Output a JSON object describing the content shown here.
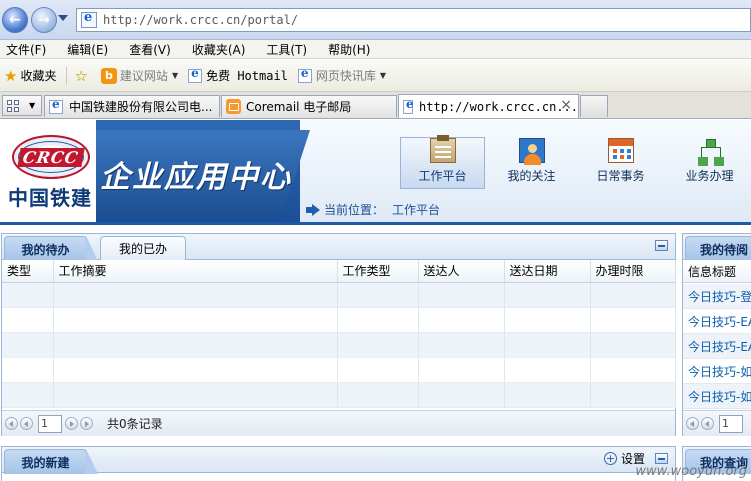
{
  "browser": {
    "address": "http://work.crcc.cn/portal/",
    "menu": [
      "文件(F)",
      "编辑(E)",
      "查看(V)",
      "收藏夹(A)",
      "工具(T)",
      "帮助(H)"
    ],
    "favorites": {
      "main": "收藏夹",
      "suggested": "建议网站",
      "hotmail": "免费 Hotmail",
      "webslice": "网页快讯库"
    },
    "tabs": [
      {
        "title": "中国铁建股份有限公司电..."
      },
      {
        "title": "Coremail 电子邮局"
      },
      {
        "title": "http://work.crcc.cn...",
        "close": "×"
      }
    ]
  },
  "header": {
    "logo_text": "CRCC",
    "logo_cn": "中国铁建",
    "site_title": "企业应用中心",
    "nav": [
      {
        "label": "工作平台",
        "icon": "workbench-icon",
        "active": true
      },
      {
        "label": "我的关注",
        "icon": "focus-person-icon"
      },
      {
        "label": "日常事务",
        "icon": "calendar-icon"
      },
      {
        "label": "业务办理",
        "icon": "org-chart-icon"
      }
    ],
    "breadcrumb": {
      "label": "当前位置：",
      "value": "工作平台"
    }
  },
  "todo_panel": {
    "tabs": [
      "我的待办",
      "我的已办"
    ],
    "columns": [
      "类型",
      "工作摘要",
      "工作类型",
      "送达人",
      "送达日期",
      "办理时限"
    ],
    "rows": [
      [],
      [],
      [],
      [],
      []
    ],
    "pager": {
      "page": "1",
      "info": "共0条记录"
    }
  },
  "read_panel": {
    "title": "我的待阅",
    "column": "信息标题",
    "items": [
      "今日技巧-登",
      "今日技巧-EA",
      "今日技巧-EA",
      "今日技巧-如",
      "今日技巧-如"
    ],
    "pager": {
      "page": "1"
    }
  },
  "new_panel": {
    "title": "我的新建",
    "settings": "设置"
  },
  "query_panel": {
    "title": "我的查询"
  },
  "watermark": "www.wooyun.org"
}
